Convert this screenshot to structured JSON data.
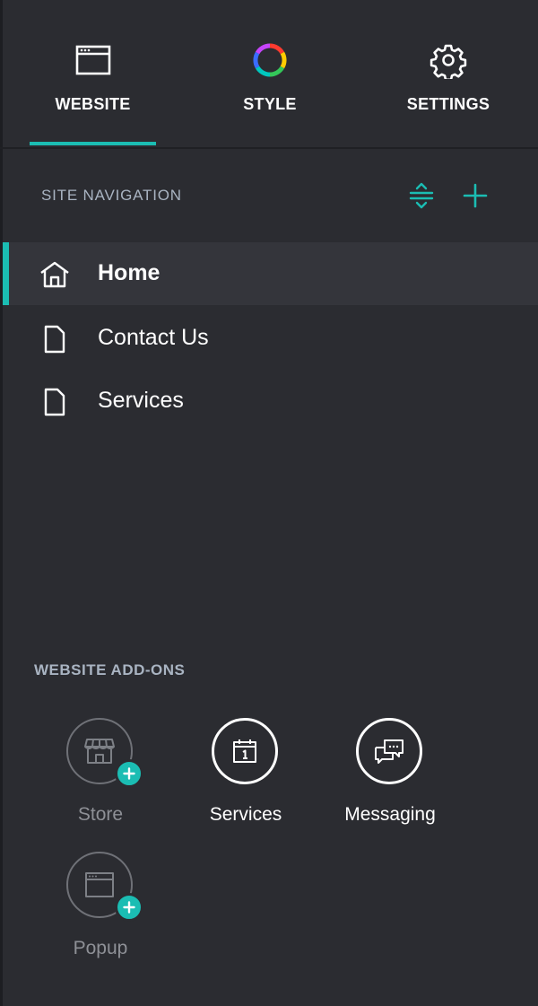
{
  "tabs": [
    {
      "label": "WEBSITE",
      "icon": "browser-window-icon",
      "active": true
    },
    {
      "label": "STYLE",
      "icon": "color-wheel-icon",
      "active": false
    },
    {
      "label": "SETTINGS",
      "icon": "gear-icon",
      "active": false
    }
  ],
  "site_navigation": {
    "title": "SITE NAVIGATION",
    "reorder_icon": "reorder-icon",
    "add_icon": "plus-icon",
    "pages": [
      {
        "label": "Home",
        "icon": "home-icon",
        "active": true
      },
      {
        "label": "Contact Us",
        "icon": "page-icon",
        "active": false
      },
      {
        "label": "Services",
        "icon": "page-icon",
        "active": false
      }
    ]
  },
  "addons": {
    "title": "WEBSITE ADD-ONS",
    "items": [
      {
        "label": "Store",
        "icon": "storefront-icon",
        "enabled": false
      },
      {
        "label": "Services",
        "icon": "calendar-icon",
        "enabled": true
      },
      {
        "label": "Messaging",
        "icon": "chat-bubbles-icon",
        "enabled": true
      },
      {
        "label": "Popup",
        "icon": "browser-window-icon",
        "enabled": false
      }
    ]
  },
  "colors": {
    "background": "#2b2c31",
    "active_row": "#34353b",
    "accent": "#1bbdb3",
    "section_title": "#a9b4c2",
    "disabled": "#8e9096",
    "text": "#ffffff"
  }
}
